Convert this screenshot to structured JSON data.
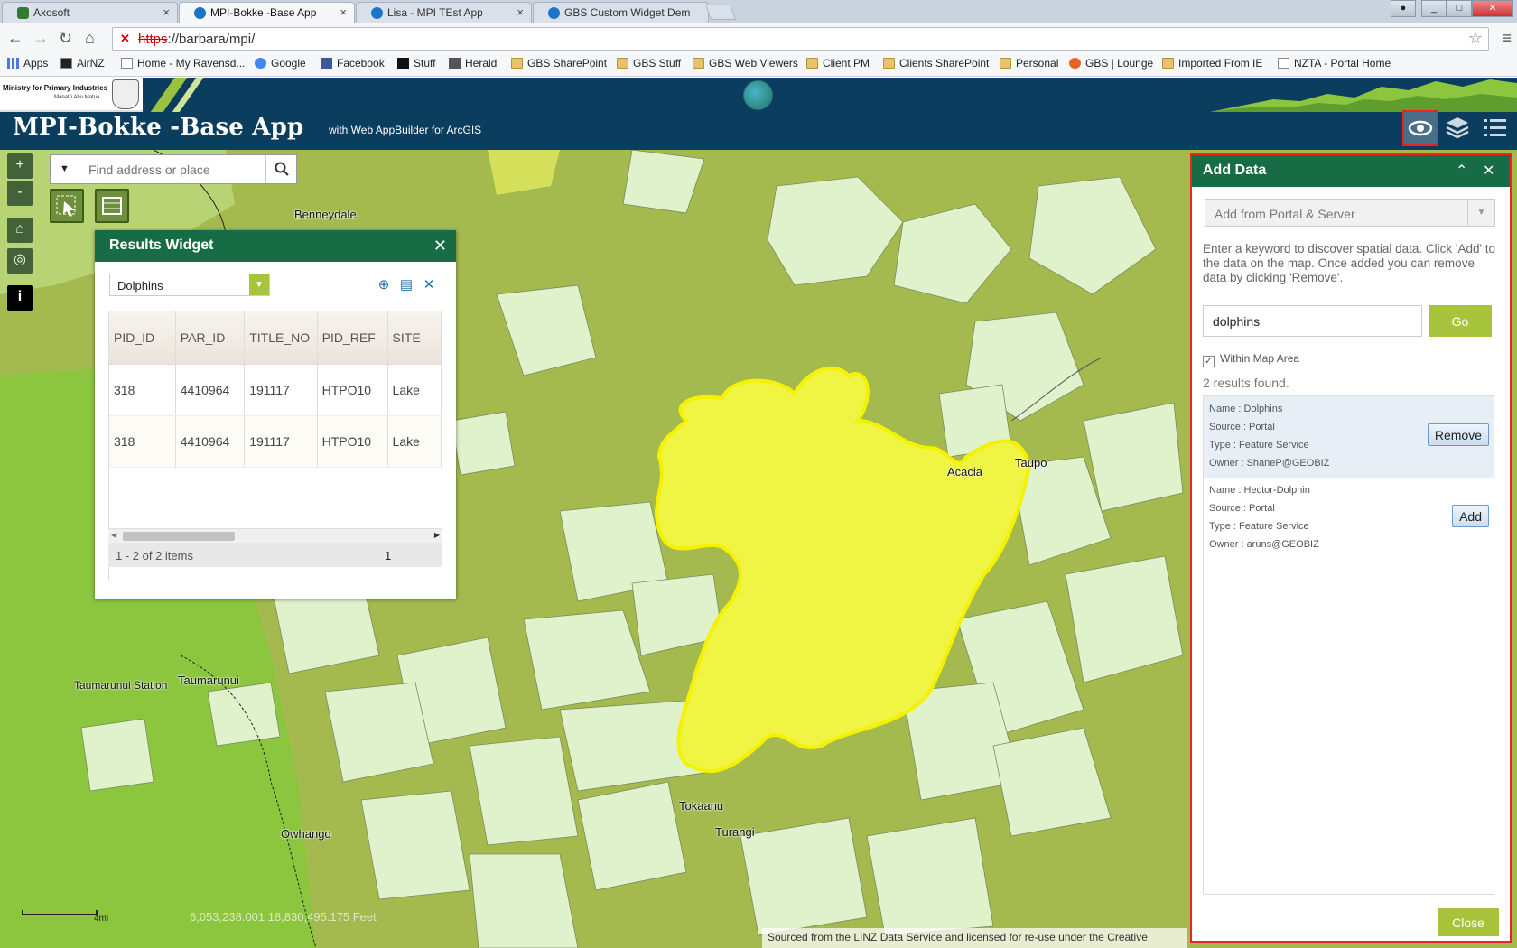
{
  "browser": {
    "tabs": [
      {
        "title": "Axosoft",
        "fav": "#2f7b2f"
      },
      {
        "title": "MPI-Bokke -Base App",
        "fav": "#1d72c9"
      },
      {
        "title": "Lisa - MPI TEst App",
        "fav": "#1d72c9"
      },
      {
        "title": "GBS Custom Widget Dem",
        "fav": "#1d72c9"
      }
    ],
    "url_proto": "https",
    "url_rest": "://barbara/mpi/",
    "bookmarks": [
      {
        "label": "Apps",
        "icon": "apps"
      },
      {
        "label": "AirNZ",
        "icon": "page"
      },
      {
        "label": "Home - My Ravensd...",
        "icon": "page"
      },
      {
        "label": "Google",
        "icon": "page"
      },
      {
        "label": "Facebook",
        "icon": "page"
      },
      {
        "label": "Stuff",
        "icon": "page"
      },
      {
        "label": "Herald",
        "icon": "page"
      },
      {
        "label": "GBS SharePoint",
        "icon": "folder"
      },
      {
        "label": "GBS Stuff",
        "icon": "folder"
      },
      {
        "label": "GBS Web Viewers",
        "icon": "folder"
      },
      {
        "label": "Client PM",
        "icon": "folder"
      },
      {
        "label": "Clients SharePoint",
        "icon": "folder"
      },
      {
        "label": "Personal",
        "icon": "folder"
      },
      {
        "label": "GBS | Lounge",
        "icon": "page"
      },
      {
        "label": "Imported From IE",
        "icon": "folder"
      },
      {
        "label": "NZTA - Portal Home",
        "icon": "page"
      }
    ]
  },
  "app": {
    "logo_line1": "Ministry for Primary Industries",
    "logo_line2": "Manatū Ahu Matua",
    "title": "MPI-Bokke -Base App",
    "subtitle": "with Web AppBuilder for ArcGIS"
  },
  "map": {
    "search_placeholder": "Find address or place",
    "zoom_in": "+",
    "zoom_out": "-",
    "coords": "6,053,238.001  18,830,495.175 Feet",
    "scale_label": "4mi",
    "attribution": "Sourced from the LINZ Data Service and licensed for re-use under the Creative",
    "places": [
      "Benneydale",
      "Taumarunui Station",
      "Taumarunui",
      "Owhango",
      "Acacia",
      "Taupo",
      "Tokaanu",
      "Turangi"
    ]
  },
  "results_widget": {
    "title": "Results Widget",
    "layer": "Dolphins",
    "columns": [
      "PID_ID",
      "PAR_ID",
      "TITLE_NO",
      "PID_REF",
      "SITE"
    ],
    "rows": [
      [
        "318",
        "4410964",
        "191117",
        "HTPO10",
        "Lake"
      ],
      [
        "318",
        "4410964",
        "191117",
        "HTPO10",
        "Lake"
      ]
    ],
    "footer": "1 - 2 of 2 items",
    "page": "1"
  },
  "add_data": {
    "title": "Add Data",
    "source": "Add from Portal & Server",
    "instructions": "Enter a keyword to discover spatial data. Click 'Add' to the data on the map. Once added you can remove data by clicking 'Remove'.",
    "keyword": "dolphins",
    "go_label": "Go",
    "within_label": "Within Map Area",
    "count": "2 results found.",
    "results": [
      {
        "name": "Name : Dolphins",
        "source": "Source : Portal",
        "type": "Type : Feature Service",
        "owner": "Owner : ShaneP@GEOBIZ",
        "action": "Remove"
      },
      {
        "name": "Name : Hector-Dolphin",
        "source": "Source : Portal",
        "type": "Type : Feature Service",
        "owner": "Owner : aruns@GEOBIZ",
        "action": "Add"
      }
    ],
    "close_label": "Close"
  },
  "colors": {
    "header": "#0b3e5e",
    "panel_header": "#176c45",
    "accent": "#a8c43c",
    "highlight": "#f3f74a"
  }
}
